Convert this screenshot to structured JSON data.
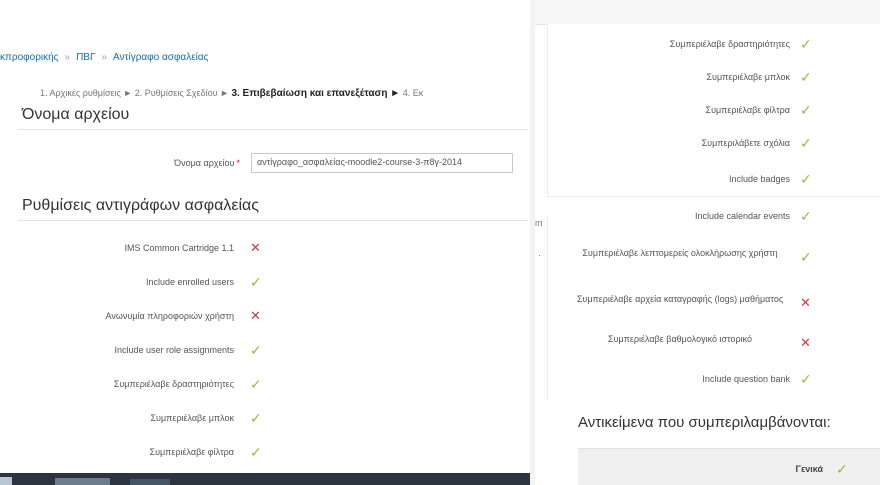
{
  "breadcrumb": {
    "items": [
      "κπροφορικής",
      "ΠΒΓ",
      "Αντίγραφο ασφαλείας"
    ],
    "separator": "»"
  },
  "progress": {
    "done": "1. Αρχικές ρυθμίσεις ► 2. Ρυθμίσεις Σχεδίου ►",
    "current": "3. Επιβεβαίωση και επανεξέταση ►",
    "next": "4. Εκ"
  },
  "filename_section": {
    "title": "Όνομα αρχείου",
    "field_label": "Όνομα αρχείου",
    "required_mark": "*",
    "field_value": "αντίγραφο_ασφαλείας-moodle2-course-3-π8γ-2014"
  },
  "settings_section": {
    "title": "Ρυθμίσεις αντιγράφων ασφαλείας",
    "rows": [
      {
        "label": "IMS Common Cartridge 1.1",
        "status": "no"
      },
      {
        "label": "Include enrolled users",
        "status": "yes"
      },
      {
        "label": "Ανωνυμία πληροφοριών χρήστη",
        "status": "no"
      },
      {
        "label": "Include user role assignments",
        "status": "yes"
      },
      {
        "label": "Συμπεριέλαβε δραστηριότητες",
        "status": "yes"
      },
      {
        "label": "Συμπεριέλαβε μπλοκ",
        "status": "yes"
      },
      {
        "label": "Συμπεριέλαβε φίλτρα",
        "status": "yes"
      }
    ]
  },
  "right_panel": {
    "rows": [
      {
        "label": "Συμπεριέλαβε δραστηριότητες",
        "status": "yes"
      },
      {
        "label": "Συμπεριέλαβε μπλοκ",
        "status": "yes"
      },
      {
        "label": "Συμπεριέλαβε φίλτρα",
        "status": "yes"
      },
      {
        "label": "Συμπεριλάβετε σχόλια",
        "status": "yes"
      },
      {
        "label": "Include badges",
        "status": "yes"
      },
      {
        "label": "Include calendar events",
        "status": "yes"
      },
      {
        "label": "Συμπεριέλαβε λεπτομερείς ολοκλήρωσης χρήστη",
        "status": "yes"
      },
      {
        "label": "Συμπεριέλαβε αρχεία καταγραφής (logs) μαθήματος",
        "status": "no"
      },
      {
        "label": "Συμπεριέλαβε βαθμολογικό ιστορικό",
        "status": "no"
      },
      {
        "label": "Include question bank",
        "status": "yes"
      }
    ],
    "side_tag": "m",
    "included_heading": "Αντικείμενα που συμπεριλαμβάνονται:",
    "table_first_row": {
      "label": "Γενικά",
      "status": "yes"
    }
  },
  "icons": {
    "yes": "✓",
    "no": "✕"
  },
  "colors": {
    "yes": "#8bbf3f",
    "no": "#d9363e",
    "link": "#0a72b3"
  }
}
